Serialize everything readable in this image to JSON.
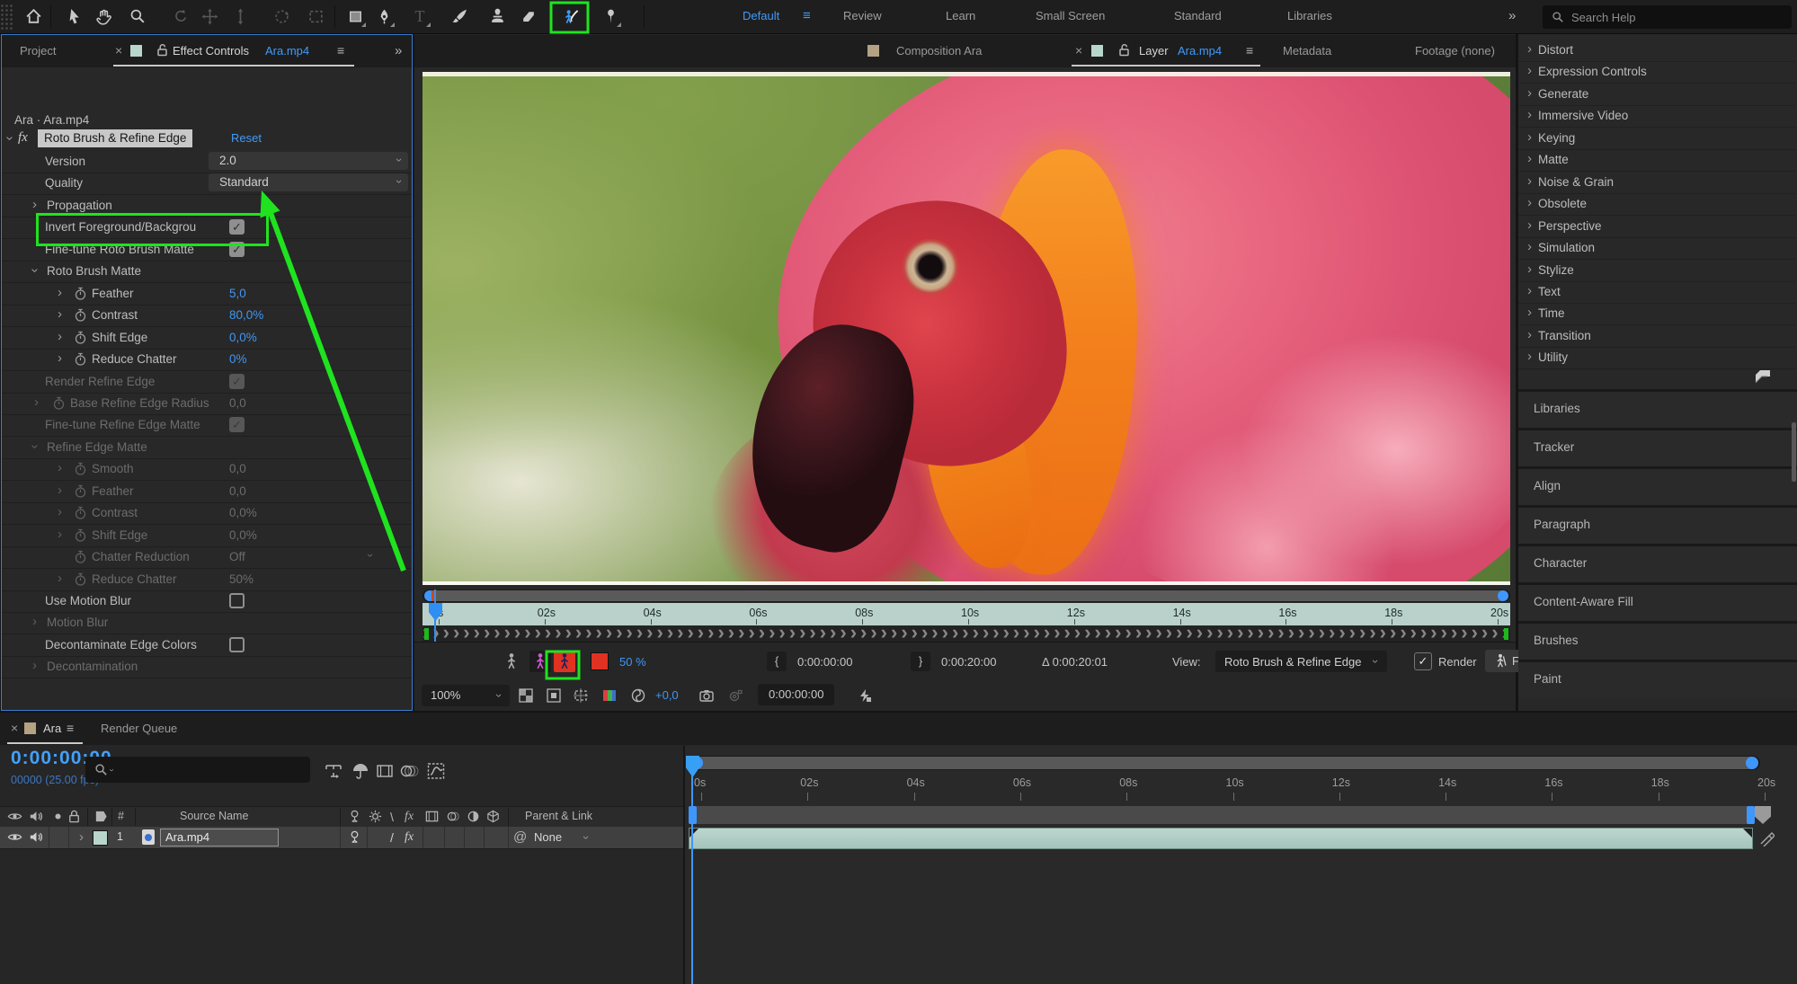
{
  "titlebar": {
    "workspaces": [
      "Default",
      "Review",
      "Learn",
      "Small Screen",
      "Standard",
      "Libraries"
    ],
    "active_workspace": "Default",
    "overflow_icon": "double-chevron-right",
    "search_help": "Search Help"
  },
  "toolbar_tools": [
    "home",
    "selection",
    "hand",
    "zoom",
    "rotate",
    "unified-camera",
    "dolly",
    "orbit",
    "camera-frame",
    "rectangle",
    "pen",
    "type",
    "brush",
    "clone-stamp",
    "eraser",
    "roto-brush",
    "puppet-pin"
  ],
  "effect_panel": {
    "tab_inactive": "Project",
    "tab_close": "×",
    "tab_label": "Effect Controls",
    "tab_target": "Ara.mp4",
    "tab_menu": "≡",
    "overflow": "»",
    "source_line": "Ara · Ara.mp4",
    "fx_glyph": "fx",
    "effect_name": "Roto Brush & Refine Edge",
    "reset_label": "Reset",
    "rows": [
      {
        "cls": "r-prop",
        "label": "Version",
        "value": "2.0",
        "dd": true
      },
      {
        "cls": "r-prop",
        "label": "Quality",
        "value": "Standard",
        "dd": true
      },
      {
        "cls": "r-group",
        "twirl": "c",
        "label": "Propagation"
      },
      {
        "cls": "r-prop",
        "label": "Invert Foreground/Backgrou",
        "cb": "on",
        "hi": true
      },
      {
        "cls": "r-prop",
        "label": "Fine-tune Roto Brush Matte",
        "cb": "on"
      },
      {
        "cls": "r-group",
        "twirl": "o",
        "label": "Roto Brush Matte"
      },
      {
        "cls": "r-sub",
        "twirl": "c",
        "sw": 1,
        "label": "Feather",
        "value": "5,0",
        "vtype": "link"
      },
      {
        "cls": "r-sub",
        "twirl": "c",
        "sw": 1,
        "label": "Contrast",
        "value": "80,0%",
        "vtype": "link"
      },
      {
        "cls": "r-sub",
        "twirl": "c",
        "sw": 1,
        "label": "Shift Edge",
        "value": "0,0%",
        "vtype": "link"
      },
      {
        "cls": "r-sub",
        "twirl": "c",
        "sw": 1,
        "label": "Reduce Chatter",
        "value": "0%",
        "vtype": "link"
      },
      {
        "cls": "r-prop",
        "label": "Render Refine Edge",
        "cb": "on",
        "dis": 1
      },
      {
        "cls": "r-mid",
        "twirl": "c",
        "sw": 1,
        "label": "Base Refine Edge Radius",
        "value": "0,0",
        "dis": 1
      },
      {
        "cls": "r-prop",
        "label": "Fine-tune Refine Edge Matte",
        "cb": "on",
        "dis": 1
      },
      {
        "cls": "r-group",
        "twirl": "o",
        "label": "Refine Edge Matte",
        "dis": 1
      },
      {
        "cls": "r-sub",
        "twirl": "c",
        "sw": 1,
        "label": "Smooth",
        "value": "0,0",
        "dis": 1
      },
      {
        "cls": "r-sub",
        "twirl": "c",
        "sw": 1,
        "label": "Feather",
        "value": "0,0",
        "dis": 1
      },
      {
        "cls": "r-sub",
        "twirl": "c",
        "sw": 1,
        "label": "Contrast",
        "value": "0,0%",
        "dis": 1
      },
      {
        "cls": "r-sub",
        "twirl": "c",
        "sw": 1,
        "label": "Shift Edge",
        "value": "0,0%",
        "dis": 1
      },
      {
        "cls": "r-sub",
        "sw": 1,
        "label": "Chatter Reduction",
        "value": "Off",
        "dis": 1,
        "ddchev": 1
      },
      {
        "cls": "r-sub",
        "twirl": "c",
        "sw": 1,
        "label": "Reduce Chatter",
        "value": "50%",
        "dis": 1
      },
      {
        "cls": "r-prop",
        "label": "Use Motion Blur",
        "cb": "off"
      },
      {
        "cls": "r-group",
        "twirl": "c",
        "label": "Motion Blur",
        "dis": 1
      },
      {
        "cls": "r-prop",
        "label": "Decontaminate Edge Colors",
        "cb": "off"
      },
      {
        "cls": "r-group",
        "twirl": "c",
        "label": "Decontamination",
        "dis": 1
      }
    ]
  },
  "viewer": {
    "tabs": {
      "comp": "Composition Ara",
      "close": "×",
      "layer_prefix": "Layer",
      "layer_name": "Ara.mp4",
      "menu": "≡",
      "metadata": "Metadata",
      "footage": "Footage (none)"
    },
    "ruler": [
      "0s",
      "02s",
      "04s",
      "06s",
      "08s",
      "10s",
      "12s",
      "14s",
      "16s",
      "18s",
      "20s"
    ],
    "chevron_char": "›",
    "controls": {
      "opacity": "50 %",
      "in_brace": "{",
      "out_brace": "}",
      "in_time": "0:00:00:00",
      "out_time": "0:00:20:00",
      "duration": "Δ 0:00:20:01",
      "view_label": "View:",
      "view_value": "Roto Brush & Refine Edge",
      "render_check": "✓",
      "render_label": "Render",
      "freeze_label": "Freeze"
    },
    "statusbar": {
      "zoom": "100%",
      "exposure": "+0,0",
      "timecode": "0:00:00:00"
    }
  },
  "effects_presets": {
    "categories": [
      "Distort",
      "Expression Controls",
      "Generate",
      "Immersive Video",
      "Keying",
      "Matte",
      "Noise & Grain",
      "Obsolete",
      "Perspective",
      "Simulation",
      "Stylize",
      "Text",
      "Time",
      "Transition",
      "Utility"
    ]
  },
  "side_panels": [
    "Libraries",
    "Tracker",
    "Align",
    "Paragraph",
    "Character",
    "Content-Aware Fill",
    "Brushes",
    "Paint"
  ],
  "timeline": {
    "tab_close": "×",
    "tab": "Ara",
    "tab_menu": "≡",
    "tab2": "Render Queue",
    "timecode": "0:00:00:00",
    "frame_info": "00000 (25.00 fps)",
    "columns": {
      "number": "#",
      "source": "Source Name",
      "parent": "Parent & Link"
    },
    "layer": {
      "index": "1",
      "name": "Ara.mp4",
      "parent": "None",
      "pickwhip": "@",
      "quality": "/",
      "fx": "fx"
    },
    "ruler": [
      "0s",
      "02s",
      "04s",
      "06s",
      "08s",
      "10s",
      "12s",
      "14s",
      "16s",
      "18s",
      "20s"
    ]
  },
  "colors": {
    "accent_blue": "#3f9bfa",
    "value_blue": "#4096f3",
    "highlight_green": "#1fe31f",
    "ruler_teal": "#b9d1ca",
    "layer_teal": "#aecbc4",
    "swatch_tan": "#b3a283",
    "swatch_teal": "#b9d6cd",
    "swatch_red": "#e03222"
  }
}
